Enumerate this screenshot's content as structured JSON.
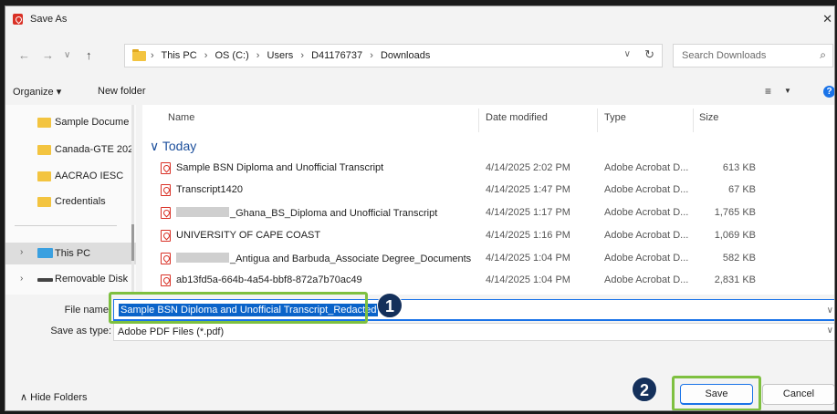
{
  "window": {
    "title": "Save As"
  },
  "nav": {
    "breadcrumbs": [
      "This PC",
      "OS (C:)",
      "Users",
      "D41176737",
      "Downloads"
    ],
    "search_placeholder": "Search Downloads"
  },
  "toolbar": {
    "organize": "Organize ▾",
    "new_folder": "New folder"
  },
  "navpane": {
    "items": [
      {
        "label": "Sample Docume"
      },
      {
        "label": "Canada-GTE 202"
      },
      {
        "label": "AACRAO IESC"
      },
      {
        "label": "Credentials"
      },
      {
        "label": "This PC"
      },
      {
        "label": "Removable Disk"
      }
    ]
  },
  "filelist": {
    "columns": [
      "Name",
      "Date modified",
      "Type",
      "Size"
    ],
    "group": "Today",
    "rows": [
      {
        "prefix": "",
        "name": "Sample BSN Diploma and Unofficial Transcript",
        "date": "4/14/2025 2:02 PM",
        "type": "Adobe Acrobat D...",
        "size": "613 KB"
      },
      {
        "prefix": "",
        "name": "Transcript1420",
        "date": "4/14/2025 1:47 PM",
        "type": "Adobe Acrobat D...",
        "size": "67 KB"
      },
      {
        "prefix": "redacted",
        "name": "_Ghana_BS_Diploma and Unofficial Transcript",
        "date": "4/14/2025 1:17 PM",
        "type": "Adobe Acrobat D...",
        "size": "1,765 KB"
      },
      {
        "prefix": "",
        "name": "UNIVERSITY OF CAPE COAST",
        "date": "4/14/2025 1:16 PM",
        "type": "Adobe Acrobat D...",
        "size": "1,069 KB"
      },
      {
        "prefix": "redacted",
        "name": "_Antigua and Barbuda_Associate Degree_Documents",
        "date": "4/14/2025 1:04 PM",
        "type": "Adobe Acrobat D...",
        "size": "582 KB"
      },
      {
        "prefix": "",
        "name": "ab13fd5a-664b-4a54-bbf8-872a7b70ac49",
        "date": "4/14/2025 1:04 PM",
        "type": "Adobe Acrobat D...",
        "size": "2,831 KB"
      }
    ]
  },
  "form": {
    "file_name_label": "File name:",
    "file_name_value": "Sample BSN Diploma and Unofficial Transcript_Redacted",
    "save_as_type_label": "Save as type:",
    "save_as_type_value": "Adobe PDF Files (*.pdf)"
  },
  "footer": {
    "hide_folders": "Hide Folders",
    "save": "Save",
    "cancel": "Cancel"
  },
  "annotations": {
    "step1": "1",
    "step2": "2",
    "highlight_color": "#7ec040",
    "badge_color": "#14305b"
  }
}
